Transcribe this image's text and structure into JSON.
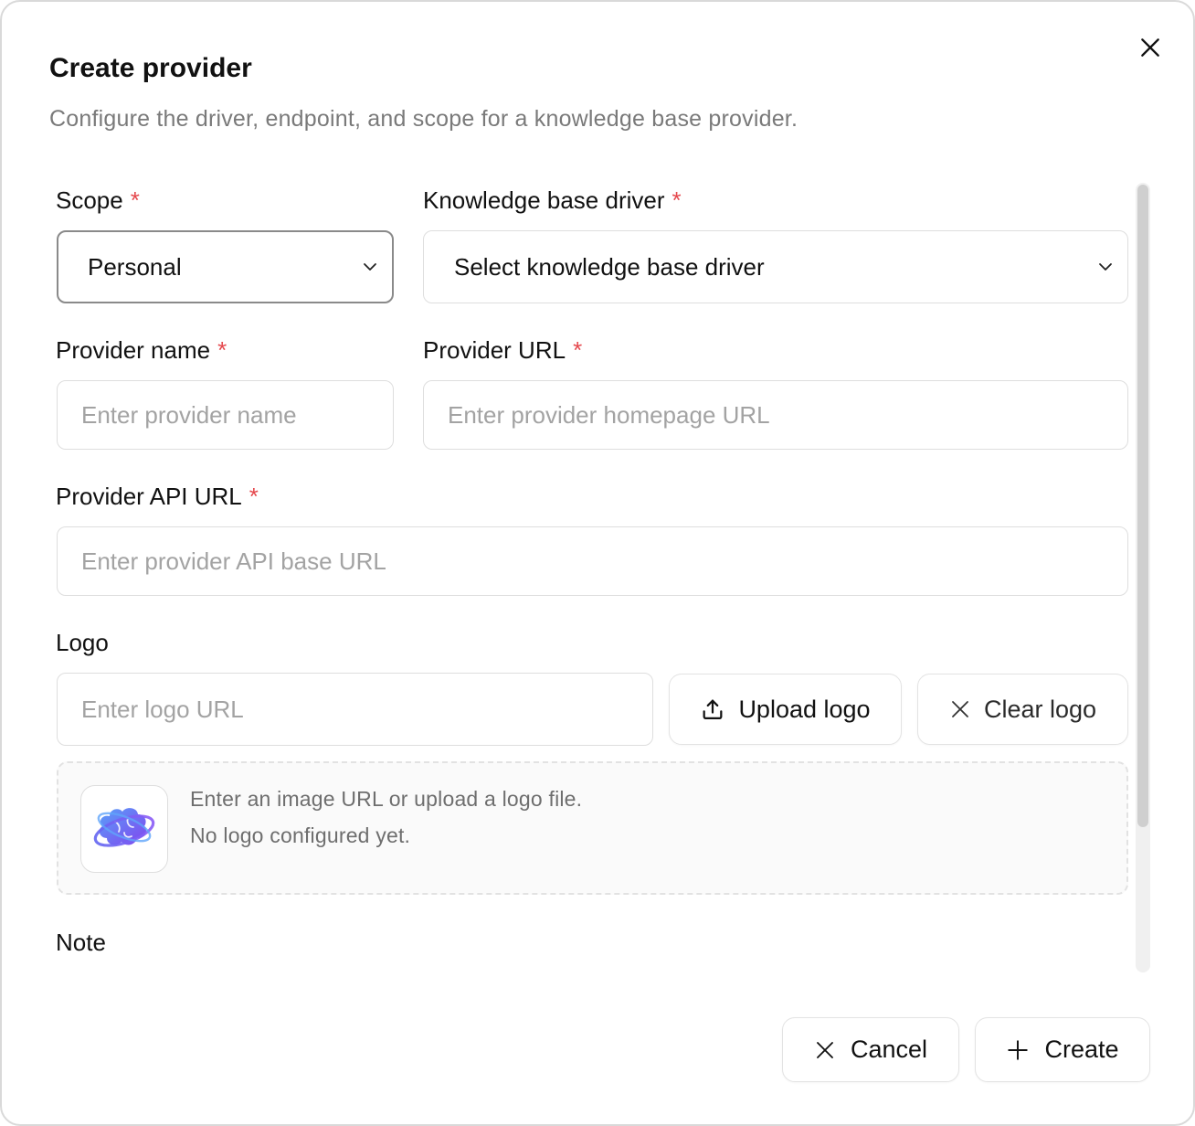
{
  "dialog": {
    "title": "Create provider",
    "subtitle": "Configure the driver, endpoint, and scope for a knowledge base provider.",
    "close_icon": "close-icon"
  },
  "form": {
    "scope": {
      "label": "Scope",
      "required": "*",
      "value": "Personal"
    },
    "driver": {
      "label": "Knowledge base driver",
      "required": "*",
      "value": "Select knowledge base driver"
    },
    "provider_name": {
      "label": "Provider name",
      "required": "*",
      "placeholder": "Enter provider name",
      "value": ""
    },
    "provider_url": {
      "label": "Provider URL",
      "required": "*",
      "placeholder": "Enter provider homepage URL",
      "value": ""
    },
    "api_url": {
      "label": "Provider API URL",
      "required": "*",
      "placeholder": "Enter provider API base URL",
      "value": ""
    },
    "logo": {
      "label": "Logo",
      "placeholder": "Enter logo URL",
      "value": "",
      "upload_label": "Upload logo",
      "upload_icon": "upload-icon",
      "clear_label": "Clear logo",
      "clear_icon": "x-icon",
      "hint_line1": "Enter an image URL or upload a logo file.",
      "hint_line2": "No logo configured yet."
    },
    "note": {
      "label": "Note"
    }
  },
  "footer": {
    "cancel_label": "Cancel",
    "cancel_icon": "x-icon",
    "create_label": "Create",
    "create_icon": "plus-icon"
  },
  "colors": {
    "required": "#e5484d",
    "text": "#111111",
    "placeholder": "#a3a3a3",
    "border": "#dedede",
    "logo_gradient_start": "#3b82f6",
    "logo_gradient_end": "#7c3aed"
  }
}
